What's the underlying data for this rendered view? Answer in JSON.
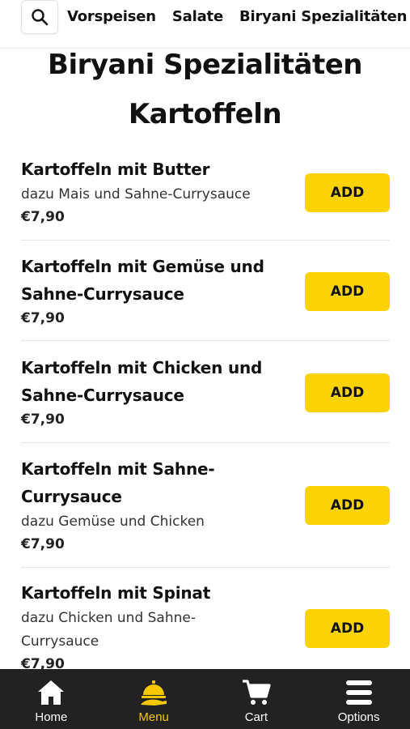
{
  "colors": {
    "accent": "#fcd307",
    "nav_background": "#222222",
    "nav_active": "#f5c800"
  },
  "categories": [
    {
      "label": "Vorspeisen"
    },
    {
      "label": "Salate"
    },
    {
      "label": "Biryani Spezialitäten"
    }
  ],
  "section_title": "Biryani Spezialitäten",
  "subsection_title": "Kartoffeln",
  "add_label": "ADD",
  "items": [
    {
      "name": "Kartoffeln mit Butter",
      "description": "dazu Mais und Sahne-Currysauce",
      "price": "€7,90"
    },
    {
      "name": "Kartoffeln mit Gemüse und Sahne-Currysauce",
      "description": "",
      "price": "€7,90"
    },
    {
      "name": "Kartoffeln mit Chicken und Sahne-Currysauce",
      "description": "",
      "price": "€7,90"
    },
    {
      "name": "Kartoffeln mit Sahne-Currysauce",
      "description": "dazu Gemüse und Chicken",
      "price": "€7,90"
    },
    {
      "name": "Kartoffeln mit Spinat",
      "description": "dazu Chicken und Sahne-Currysauce",
      "price": "€7,90"
    }
  ],
  "nav": [
    {
      "label": "Home",
      "icon": "home-icon"
    },
    {
      "label": "Menu",
      "icon": "cloche-icon",
      "active": true
    },
    {
      "label": "Cart",
      "icon": "cart-icon"
    },
    {
      "label": "Options",
      "icon": "hamburger-icon"
    }
  ]
}
